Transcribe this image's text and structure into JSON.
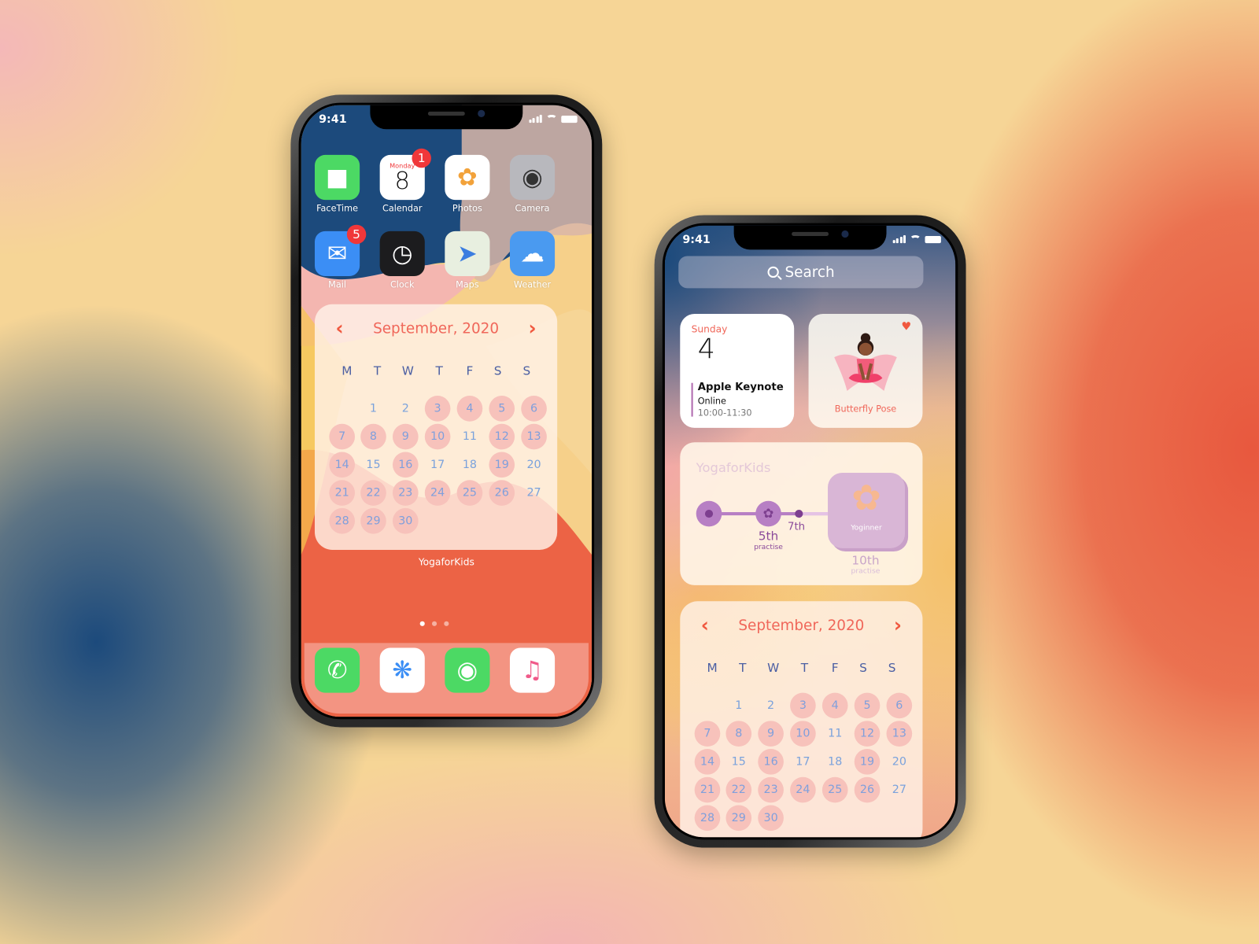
{
  "status": {
    "time": "9:41"
  },
  "phone1": {
    "apps": [
      {
        "label": "FaceTime",
        "icon": "facetime-icon",
        "bg": "#4cd964"
      },
      {
        "label": "Calendar",
        "icon": "calendar-icon",
        "bg": "#ffffff",
        "day_name": "Monday",
        "day_num": "8",
        "badge": "1"
      },
      {
        "label": "Photos",
        "icon": "photos-icon",
        "bg": "#ffffff"
      },
      {
        "label": "Camera",
        "icon": "camera-icon",
        "bg": "#b8b8bd"
      },
      {
        "label": "Mail",
        "icon": "mail-icon",
        "bg": "#3b8ef5",
        "badge": "5"
      },
      {
        "label": "Clock",
        "icon": "clock-icon",
        "bg": "#1c1c1e"
      },
      {
        "label": "Maps",
        "icon": "maps-icon",
        "bg": "#e8efe0"
      },
      {
        "label": "Weather",
        "icon": "weather-icon",
        "bg": "#4a9af0"
      }
    ],
    "widget_caption": "YogaforKids",
    "page_dots": 3,
    "dock": [
      {
        "icon": "phone-icon",
        "bg": "#4cd964"
      },
      {
        "icon": "safari-icon",
        "bg": "#ffffff"
      },
      {
        "icon": "messages-icon",
        "bg": "#4cd964"
      },
      {
        "icon": "music-icon",
        "bg": "#ffffff"
      }
    ]
  },
  "calendar": {
    "title": "September, 2020",
    "weekdays": [
      "M",
      "T",
      "W",
      "T",
      "F",
      "S",
      "S"
    ],
    "start_offset": 1,
    "days": 30,
    "highlighted": [
      3,
      4,
      5,
      6,
      7,
      8,
      9,
      10,
      12,
      13,
      14,
      16,
      19,
      21,
      22,
      23,
      24,
      25,
      26,
      28,
      29,
      30
    ],
    "accent": "#f0675a"
  },
  "phone2": {
    "search_placeholder": "Search",
    "event": {
      "weekday": "Sunday",
      "day": "4",
      "title": "Apple Keynote",
      "location": "Online",
      "time": "10:00-11:30"
    },
    "pose": {
      "label": "Butterfly Pose",
      "favorite": true
    },
    "progress": {
      "title": "YogaforKids",
      "step1": "5th",
      "step1_sub": "practise",
      "step2": "7th",
      "badge": "Yoginner",
      "goal": "10th",
      "goal_sub": "practise",
      "accent": "#9b5aa8"
    }
  }
}
